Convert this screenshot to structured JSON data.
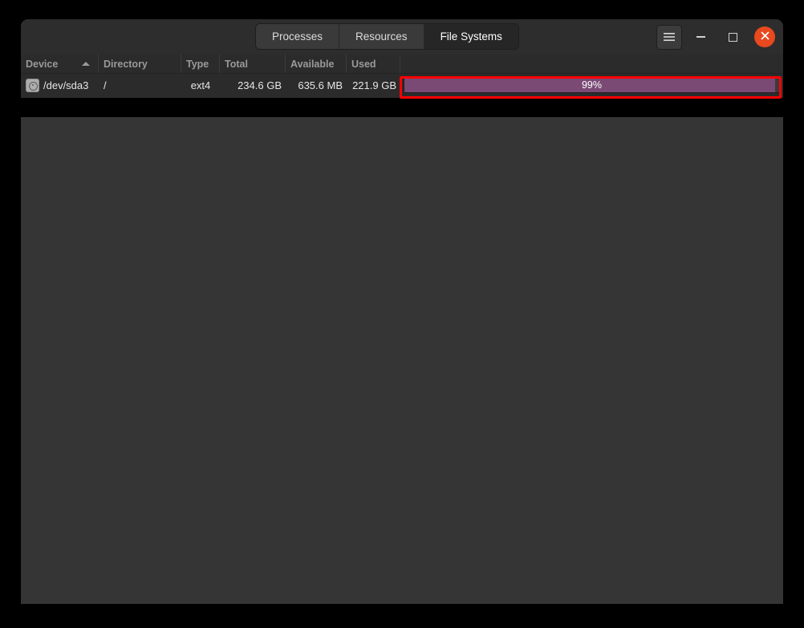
{
  "window": {
    "tabs": [
      {
        "label": "Processes",
        "active": false
      },
      {
        "label": "Resources",
        "active": false
      },
      {
        "label": "File Systems",
        "active": true
      }
    ],
    "controls": {
      "menu_icon": "hamburger-menu-icon",
      "minimize_label": "–",
      "maximize_label": "□",
      "close_label": "×"
    }
  },
  "table": {
    "columns": [
      {
        "key": "device",
        "label": "Device",
        "sorted": true,
        "sort_direction": "ascending"
      },
      {
        "key": "directory",
        "label": "Directory",
        "sorted": false,
        "sort_direction": ""
      },
      {
        "key": "type",
        "label": "Type",
        "sorted": false,
        "sort_direction": ""
      },
      {
        "key": "total",
        "label": "Total",
        "sorted": false,
        "sort_direction": ""
      },
      {
        "key": "available",
        "label": "Available",
        "sorted": false,
        "sort_direction": ""
      },
      {
        "key": "used",
        "label": "Used",
        "sorted": false,
        "sort_direction": ""
      },
      {
        "key": "usage",
        "label": "",
        "sorted": false,
        "sort_direction": ""
      }
    ],
    "rows": [
      {
        "icon": "disk-drive-icon",
        "device": "/dev/sda3",
        "directory": "/",
        "type": "ext4",
        "total": "234.6 GB",
        "available": "635.6 MB",
        "used": "221.9 GB",
        "usage_percent": 99,
        "usage_label": "99%"
      }
    ]
  },
  "annotation": {
    "highlight_target": "usage-progress-bar",
    "color": "#ff0000"
  },
  "colors": {
    "window_bg": "#2b2b2b",
    "headerbar_bg": "#2d2d2d",
    "panel_bg": "#353535",
    "progress_fill": "#7a4a75",
    "close_button": "#e8491f",
    "page_bg": "#000000"
  }
}
